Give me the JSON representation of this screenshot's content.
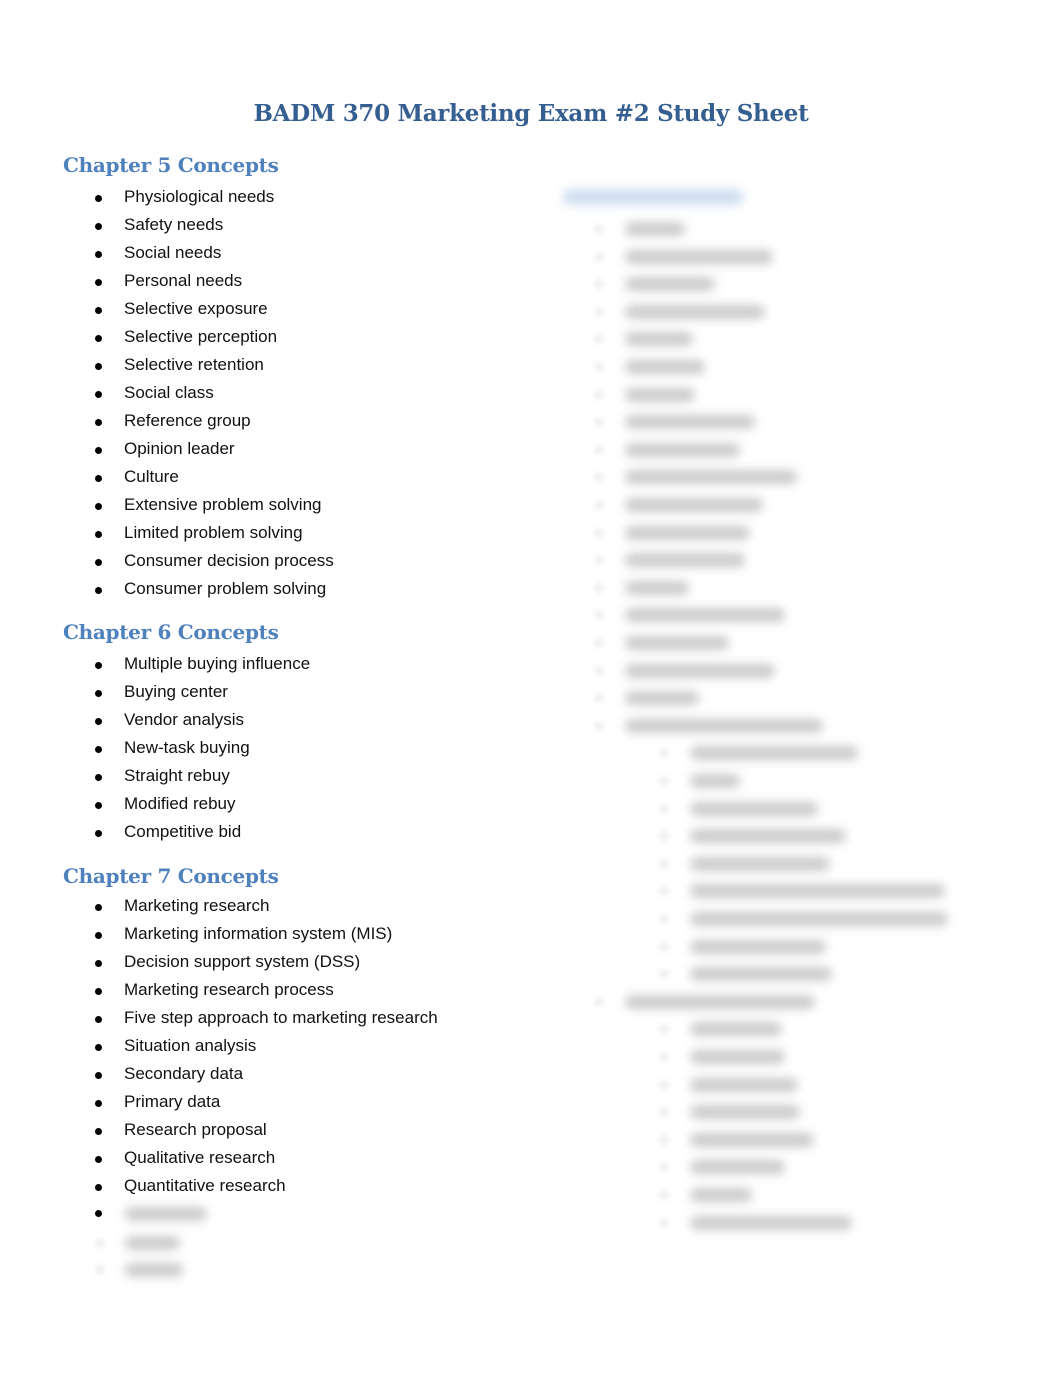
{
  "document": {
    "title": "BADM 370 Marketing Exam #2 Study Sheet",
    "sections": [
      {
        "heading": "Chapter 5 Concepts",
        "items": [
          "Physiological needs",
          "Safety needs",
          "Social needs",
          "Personal needs",
          "Selective exposure",
          "Selective perception",
          "Selective retention",
          "Social class",
          "Reference group",
          "Opinion leader",
          "Culture",
          "Extensive problem solving",
          "Limited problem solving",
          "Consumer decision process",
          "Consumer problem solving"
        ]
      },
      {
        "heading": "Chapter 6 Concepts",
        "items": [
          "Multiple buying influence",
          "Buying center",
          "Vendor analysis",
          "New-task buying",
          "Straight rebuy",
          "Modified rebuy",
          "Competitive bid"
        ]
      },
      {
        "heading": "Chapter 7 Concepts",
        "items": [
          "Marketing research",
          "Marketing information system (MIS)",
          "Decision support system (DSS)",
          "Marketing research process",
          "Five step approach to marketing research",
          "Situation analysis",
          "Secondary data",
          "Primary data",
          "Research proposal",
          "Qualitative research",
          "Quantitative research"
        ]
      }
    ],
    "obscured_note": "Remaining content (right column and final list items) is blurred/unreadable"
  }
}
